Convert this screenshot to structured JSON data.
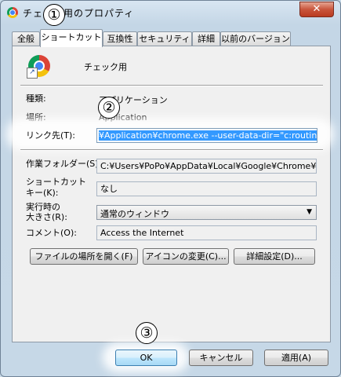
{
  "window": {
    "title": "チェック用のプロパティ",
    "close_label": "✕"
  },
  "tabs": [
    {
      "label": "全般"
    },
    {
      "label": "ショートカット"
    },
    {
      "label": "互換性"
    },
    {
      "label": "セキュリティ"
    },
    {
      "label": "詳細"
    },
    {
      "label": "以前のバージョン"
    }
  ],
  "shortcut": {
    "name": "チェック用",
    "type_label": "種類:",
    "type_value": "アプリケーション",
    "location_label": "場所:",
    "location_value": "Application",
    "target_label": "リンク先(T):",
    "target_value": "¥Application¥chrome.exe --user-data-dir=\"c:routine\"",
    "workdir_label": "作業フォルダー(S):",
    "workdir_value": "C:¥Users¥PoPo¥AppData¥Local¥Google¥Chrome¥App",
    "hotkey_label_1": "ショートカット",
    "hotkey_label_2": "キー(K):",
    "hotkey_value": "なし",
    "run_label_1": "実行時の",
    "run_label_2": "大きさ(R):",
    "run_value": "通常のウィンドウ",
    "comment_label": "コメント(O):",
    "comment_value": "Access the Internet",
    "open_location_button": "ファイルの場所を開く(F)",
    "change_icon_button": "アイコンの変更(C)...",
    "advanced_button": "詳細設定(D)..."
  },
  "footer": {
    "ok": "OK",
    "cancel": "キャンセル",
    "apply": "適用(A)"
  },
  "annotations": {
    "step1": "①",
    "step2": "②",
    "step3": "③"
  },
  "colors": {
    "selection": "#3399ff",
    "window_frame": "#c6d8e7",
    "panel": "#f0f0f0"
  }
}
